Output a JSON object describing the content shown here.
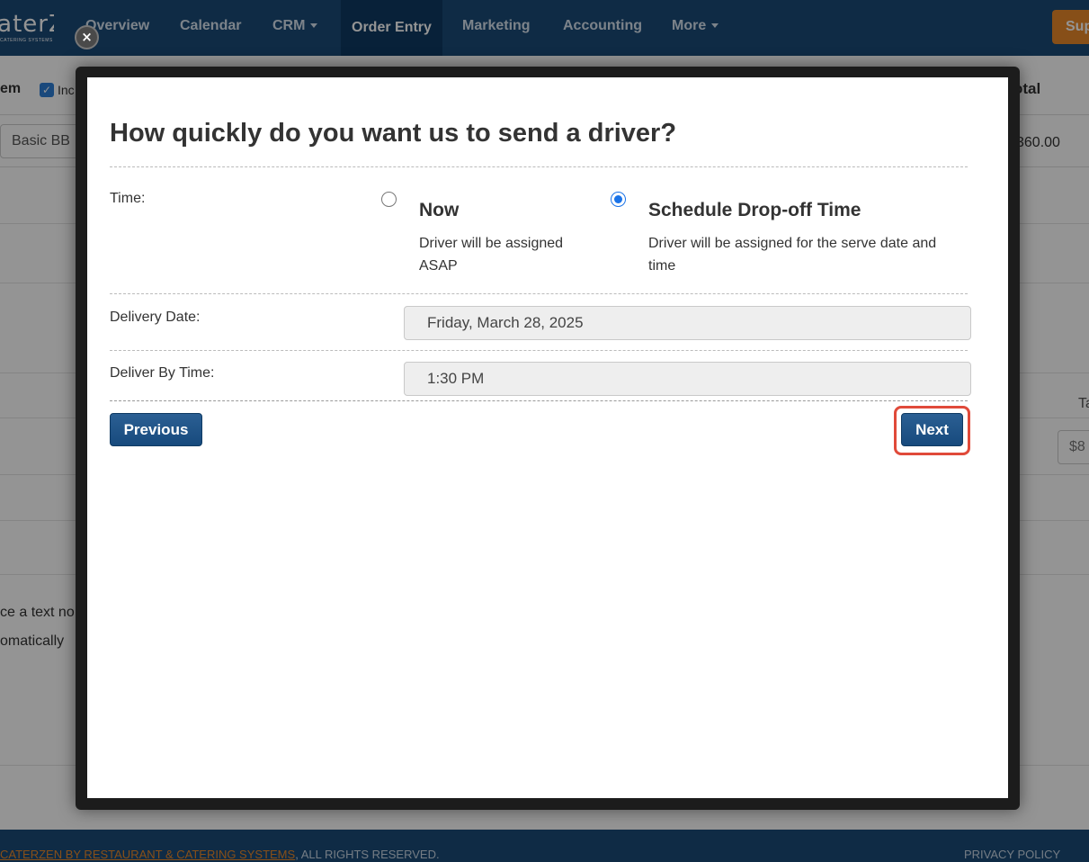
{
  "app": {
    "brand": "CaterZen",
    "brand_sub": "CATERING SYSTEMS"
  },
  "nav": {
    "items": [
      {
        "label": "Overview"
      },
      {
        "label": "Calendar"
      },
      {
        "label": "CRM"
      },
      {
        "label": "Order Entry"
      },
      {
        "label": "Marketing"
      },
      {
        "label": "Accounting"
      },
      {
        "label": "More"
      }
    ],
    "active": "Order Entry",
    "support_label": "Sup"
  },
  "background": {
    "item_label": "em",
    "include_label": "Inc",
    "total_label": "otal",
    "row_item": "Basic BB",
    "row_amount": "360.00",
    "ta_label": "Ta",
    "amount_input": "$8",
    "note_line1": "ce a text no",
    "note_line2": "omatically"
  },
  "footer": {
    "link_text": "CATERZEN BY RESTAURANT & CATERING SYSTEMS",
    "rights": ", ALL RIGHTS RESERVED.",
    "privacy": "PRIVACY POLICY"
  },
  "modal": {
    "close_symbol": "×",
    "title": "How quickly do you want us to send a driver?",
    "time_label": "Time:",
    "options": [
      {
        "title": "Now",
        "description": "Driver will be assigned ASAP",
        "selected": false
      },
      {
        "title": "Schedule Drop-off Time",
        "description": "Driver will be assigned for the serve date and time",
        "selected": true
      }
    ],
    "delivery_date_label": "Delivery Date:",
    "delivery_date_value": "Friday, March 28, 2025",
    "deliver_by_label": "Deliver By Time:",
    "deliver_by_value": "1:30 PM",
    "previous_label": "Previous",
    "next_label": "Next"
  },
  "colors": {
    "navbar": "#1a4a78",
    "button": "#174a7d",
    "highlight": "#e04a3a",
    "radio_selected": "#1a73e8",
    "accent_orange": "#e8882a"
  }
}
